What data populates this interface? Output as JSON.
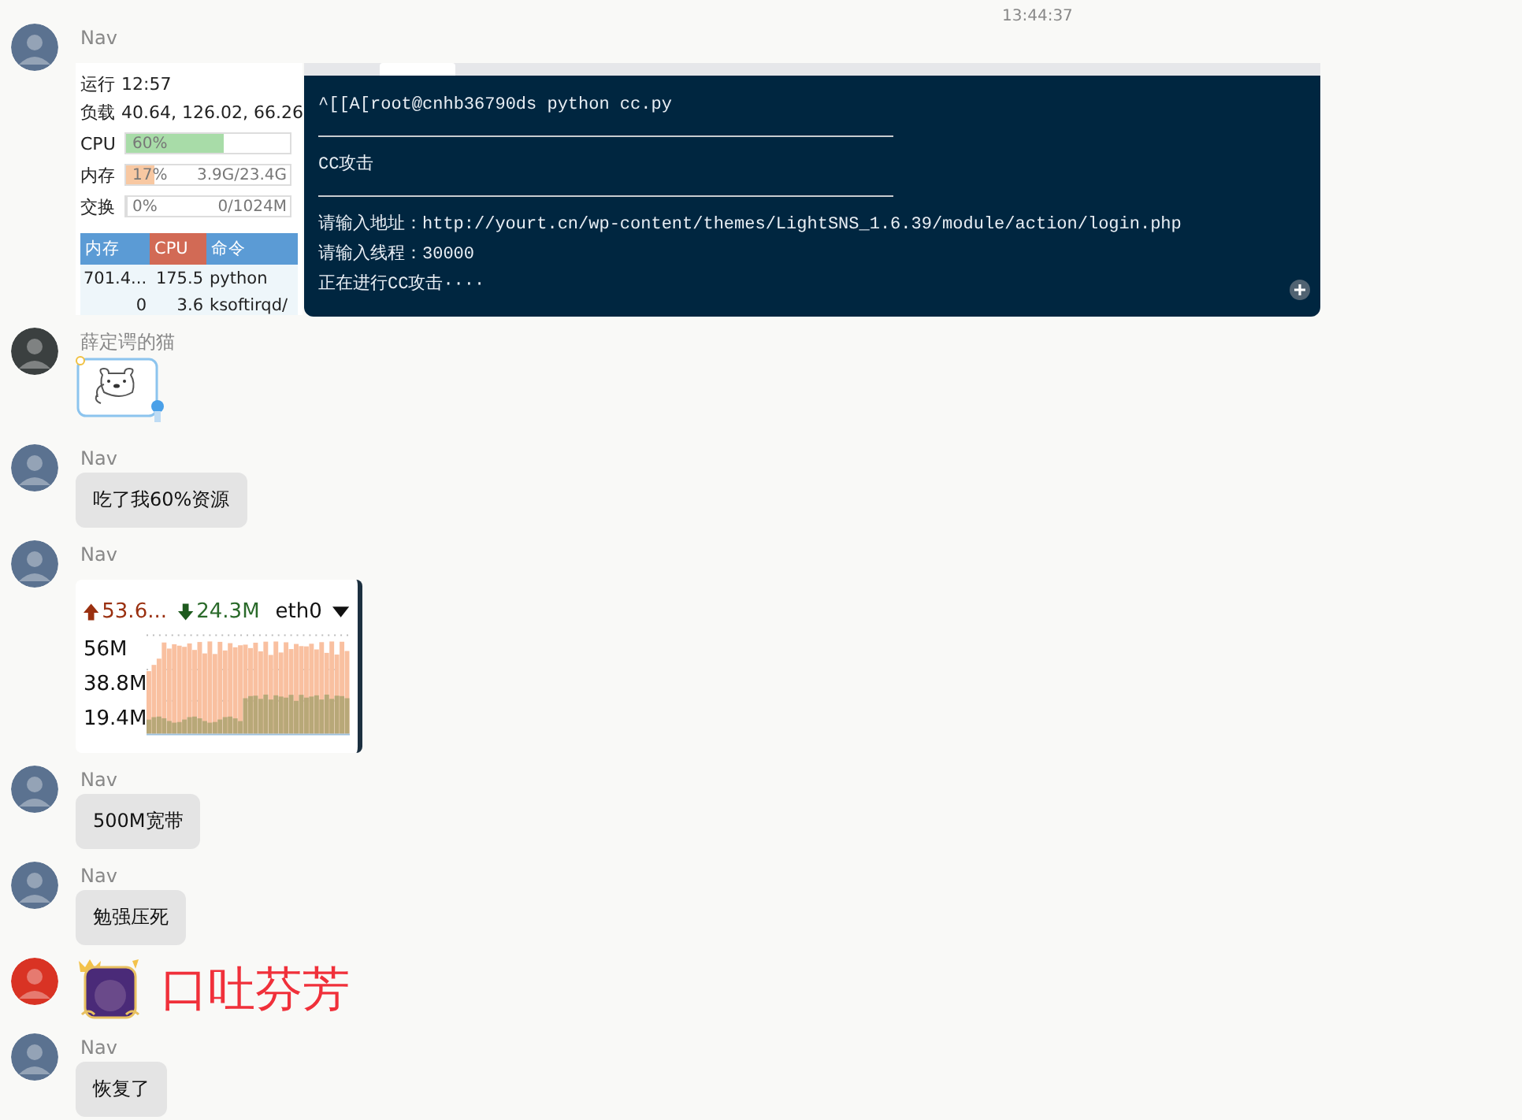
{
  "timestamp": "13:44:37",
  "messages": [
    {
      "kind": "screenshot",
      "sender": "Nav",
      "monitor": {
        "uptime_label": "运行",
        "uptime": "12:57",
        "load_label": "负载",
        "load": "40.64, 126.02, 66.26",
        "meters": [
          {
            "label": "CPU",
            "value": "60%",
            "level": 0.6,
            "color": "#a8dca8"
          },
          {
            "label": "内存",
            "value": "17%",
            "detail": "3.9G/23.4G",
            "level": 0.17,
            "color": "#f8c8a2"
          },
          {
            "label": "交换",
            "value": "0%",
            "detail": "0/1024M",
            "level": 0
          }
        ],
        "columns": [
          {
            "label": "内存",
            "selected": false
          },
          {
            "label": "CPU",
            "selected": true
          },
          {
            "label": "命令",
            "selected": false
          }
        ],
        "rows": [
          [
            "701.4...",
            "175.5",
            "python"
          ],
          [
            "0",
            "3.6",
            "ksoftirqd/"
          ]
        ]
      },
      "terminal": [
        {
          "kind": "text",
          "text": "^[[A[root@cnhb36790ds python cc.py"
        },
        {
          "kind": "rule"
        },
        {
          "kind": "text",
          "text": "CC攻击"
        },
        {
          "kind": "rule"
        },
        {
          "kind": "text",
          "text": "请输入地址：http://yourt.cn/wp-content/themes/LightSNS_1.6.39/module/action/login.php"
        },
        {
          "kind": "text",
          "text": "请输入线程：30000"
        },
        {
          "kind": "text",
          "text": "正在进行CC攻击····"
        }
      ]
    },
    {
      "kind": "sticker",
      "sender": "薛定谔的猫"
    },
    {
      "kind": "text",
      "sender": "Nav",
      "text": "吃了我60%资源"
    },
    {
      "kind": "netgraph",
      "sender": "Nav",
      "upload": "53.6...",
      "download": "24.3M",
      "interface": "eth0",
      "axis_labels": [
        "56M",
        "38.8M",
        "19.4M"
      ]
    },
    {
      "kind": "text",
      "sender": "Nav",
      "text": "500M宽带"
    },
    {
      "kind": "text",
      "sender": "Nav",
      "text": "勉强压死"
    },
    {
      "kind": "emote",
      "text": "口吐芬芳"
    },
    {
      "kind": "text",
      "sender": "Nav",
      "text": "恢复了"
    }
  ]
}
